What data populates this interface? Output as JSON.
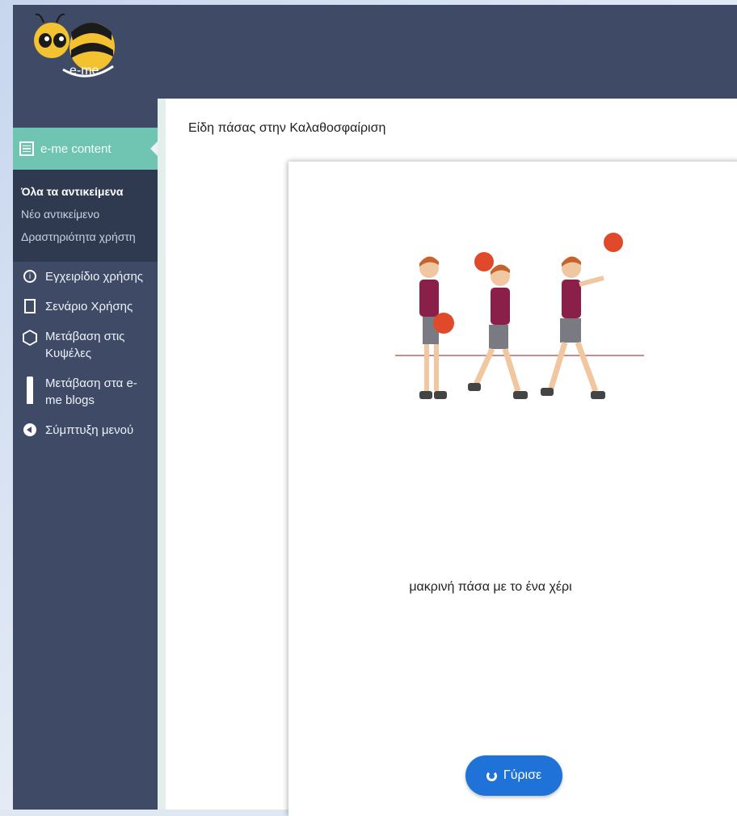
{
  "brand": {
    "logo_text": "e-me"
  },
  "sidebar": {
    "content_label": "e-me content",
    "sub_items": [
      {
        "label": "Όλα τα αντικείμενα"
      },
      {
        "label": "Νέο αντικείμενο"
      },
      {
        "label": "Δραστηριότητα χρήστη"
      }
    ],
    "items": [
      {
        "label": "Εγχειρίδιο χρήσης",
        "icon": "info-icon"
      },
      {
        "label": "Σενάριο Χρήσης",
        "icon": "document-icon"
      },
      {
        "label": "Μετάβαση στις Κυψέλες",
        "icon": "hexagon-icon"
      },
      {
        "label": "Μετάβαση στα e-me blogs",
        "icon": "pencil-icon"
      },
      {
        "label": "Σύμπτυξη μενού",
        "icon": "collapse-icon"
      }
    ]
  },
  "main": {
    "title": "Είδη πάσας στην Καλαθοσφαίριση",
    "card": {
      "caption": "μακρινή πάσα με το ένα χέρι",
      "flip_label": "Γύρισε"
    }
  },
  "colors": {
    "sidebar_bg": "#3f4b66",
    "accent": "#6fc5b1",
    "button": "#1f73d8"
  }
}
